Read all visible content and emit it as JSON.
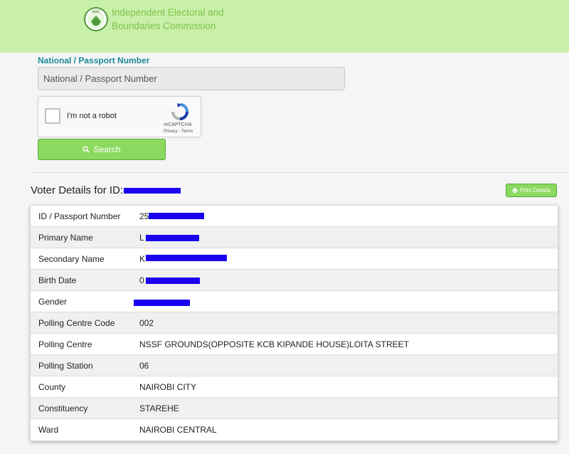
{
  "header": {
    "org_line1": "Independent Electoral and",
    "org_line2": "Boundaries Commission",
    "logo_text": "IEBC",
    "bg_color": "#c9f0a9",
    "text_color": "#7dc34a"
  },
  "form": {
    "label": "National / Passport Number",
    "placeholder": "National / Passport Number",
    "captcha": {
      "label": "I'm not a robot",
      "brand": "reCAPTCHA",
      "links": "Privacy - Terms"
    },
    "search_label": "Search",
    "search_icon": "search-icon"
  },
  "details": {
    "title_prefix": "Voter Details for ID:",
    "print_label": "Print Details",
    "print_icon": "printer-icon",
    "rows": [
      {
        "key": "ID / Passport Number",
        "value": "25",
        "redacted": true
      },
      {
        "key": "Primary Name",
        "value": "L",
        "redacted": true
      },
      {
        "key": "Secondary Name",
        "value": "K",
        "redacted": true
      },
      {
        "key": "Birth Date",
        "value": "0",
        "redacted": true
      },
      {
        "key": "Gender",
        "value": "",
        "redacted": true
      },
      {
        "key": "Polling Centre Code",
        "value": "002",
        "redacted": false
      },
      {
        "key": "Polling Centre",
        "value": "NSSF GROUNDS(OPPOSITE KCB KIPANDE HOUSE)LOITA STREET",
        "redacted": false
      },
      {
        "key": "Polling Station",
        "value": "06",
        "redacted": false
      },
      {
        "key": "County",
        "value": "NAIROBI CITY",
        "redacted": false
      },
      {
        "key": "Constituency",
        "value": "STAREHE",
        "redacted": false
      },
      {
        "key": "Ward",
        "value": "NAIROBI CENTRAL",
        "redacted": false
      }
    ]
  },
  "colors": {
    "accent_green": "#8cd960",
    "label_teal": "#1e8a9a",
    "redaction": "#1a00f0"
  }
}
